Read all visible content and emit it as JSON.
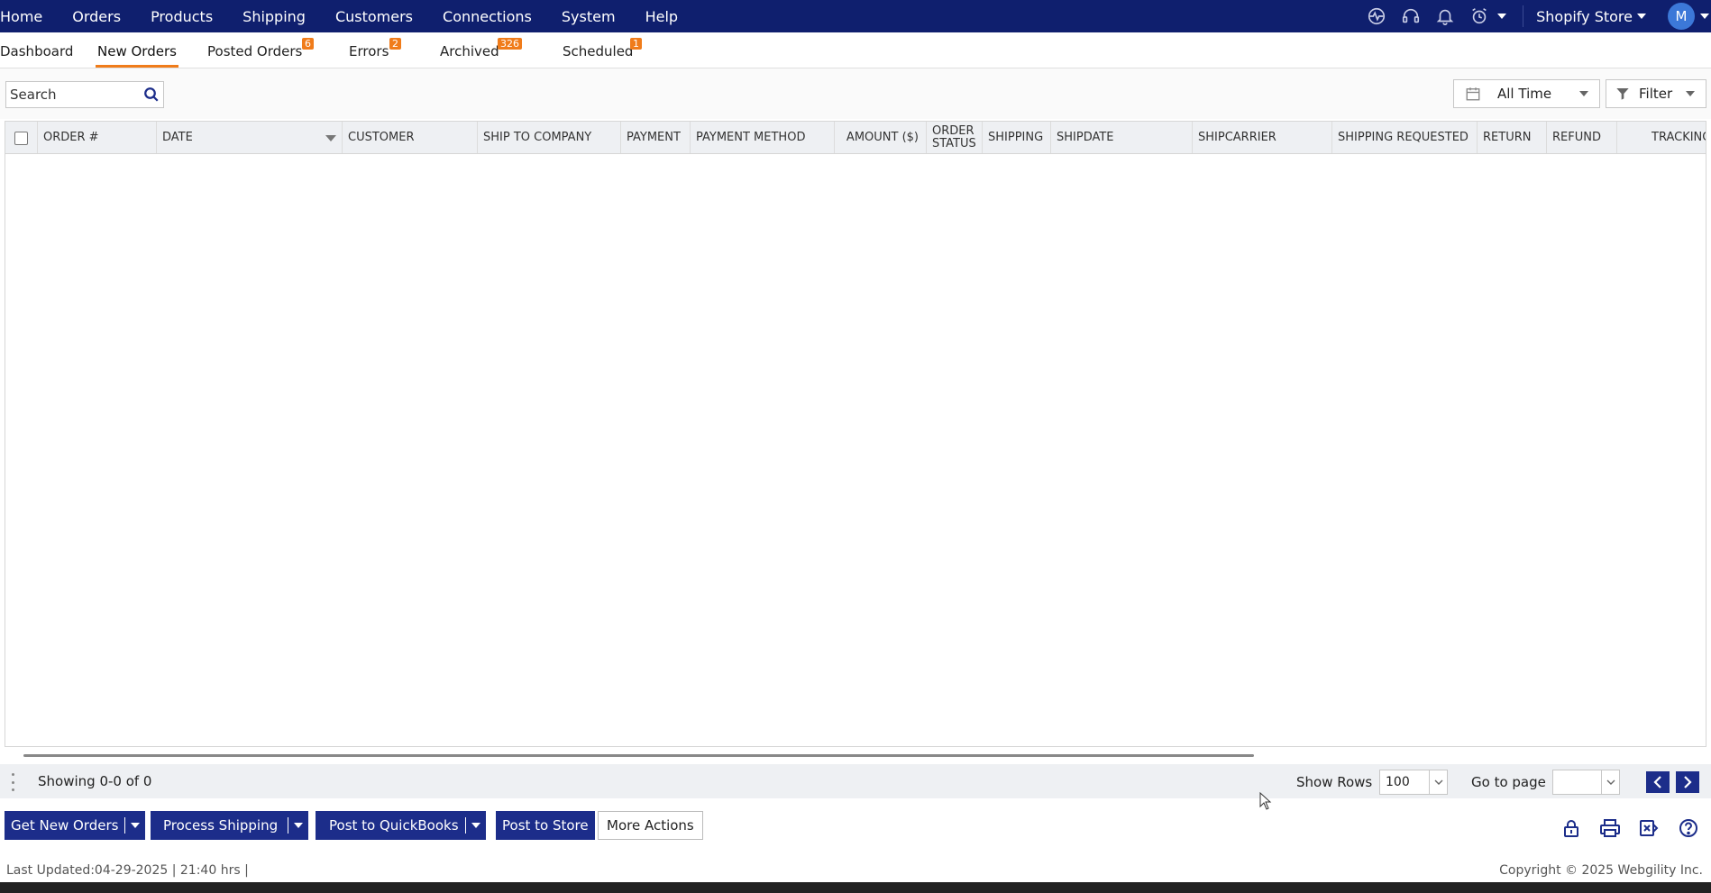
{
  "nav": {
    "menu": [
      "Home",
      "Orders",
      "Products",
      "Shipping",
      "Customers",
      "Connections",
      "System",
      "Help"
    ],
    "store": "Shopify Store",
    "avatar_initial": "M"
  },
  "tabs": [
    {
      "label": "Dashboard",
      "badge": ""
    },
    {
      "label": "New Orders",
      "badge": ""
    },
    {
      "label": "Posted Orders",
      "badge": "6"
    },
    {
      "label": "Errors",
      "badge": "2"
    },
    {
      "label": "Archived",
      "badge": "326"
    },
    {
      "label": "Scheduled",
      "badge": "1"
    }
  ],
  "toolbar": {
    "search_placeholder": "Search",
    "time_range": "All Time",
    "filter_label": "Filter"
  },
  "grid": {
    "columns": [
      {
        "label": "ORDER #"
      },
      {
        "label": "DATE"
      },
      {
        "label": "CUSTOMER"
      },
      {
        "label": "SHIP TO COMPANY"
      },
      {
        "label": "PAYMENT"
      },
      {
        "label": "PAYMENT METHOD"
      },
      {
        "label": "AMOUNT ($)"
      },
      {
        "label": "ORDER STATUS"
      },
      {
        "label": "SHIPPING"
      },
      {
        "label": "SHIPDATE"
      },
      {
        "label": "SHIPCARRIER"
      },
      {
        "label": "SHIPPING REQUESTED"
      },
      {
        "label": "RETURN"
      },
      {
        "label": "REFUND"
      },
      {
        "label": "TRACKING"
      }
    ],
    "rows": []
  },
  "footer": {
    "showing": "Showing 0-0 of 0",
    "show_rows_label": "Show Rows",
    "rows_value": "100",
    "goto_label": "Go to page",
    "goto_value": ""
  },
  "actions": {
    "get_new_orders": "Get New Orders",
    "process_shipping": "Process Shipping",
    "post_quickbooks": "Post to QuickBooks",
    "post_store": "Post to Store",
    "more_actions": "More Actions"
  },
  "status": {
    "updated": "Last Updated:04-29-2025 | 21:40 hrs |",
    "copyright": "Copyright © 2025 Webgility Inc."
  },
  "colors": {
    "nav_bg": "#0f1f6e",
    "accent": "#f07c1a",
    "button": "#1c2d8a"
  }
}
